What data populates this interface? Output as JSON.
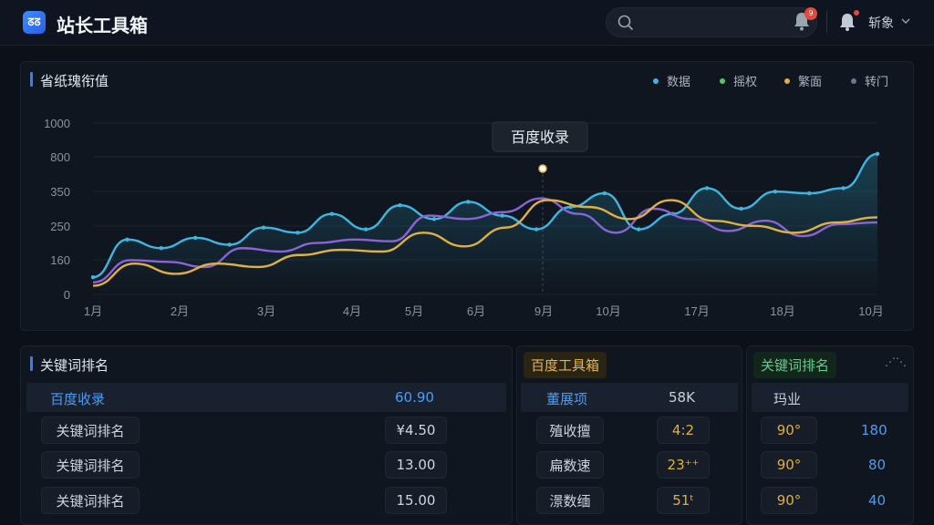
{
  "header": {
    "logo_text": "ᘔᘔ",
    "app_title": "站长工具箱",
    "search_placeholder": "",
    "notification_count": "9",
    "user_name": "斩象"
  },
  "chart_panel": {
    "title": "省纸瑰衔值",
    "legend": [
      {
        "label": "数据",
        "color": "#3fb6e0"
      },
      {
        "label": "摇权",
        "color": "#52c86a"
      },
      {
        "label": "繁面",
        "color": "#e0b040"
      },
      {
        "label": "转门",
        "color": "#7a7f9a"
      }
    ],
    "tooltip": "百度收录"
  },
  "chart_data": {
    "type": "line",
    "title": "省纸瑰衔值",
    "categories": [
      "1月",
      "2月",
      "3月",
      "4月",
      "5月",
      "6月",
      "9月",
      "10月",
      "17月",
      "18月",
      "10月"
    ],
    "yticks": [
      "1000",
      "800",
      "350",
      "250",
      "160",
      "0"
    ],
    "grid": true,
    "series": [
      {
        "color": "#3fb6e0",
        "values": [
          1.0,
          3.2,
          2.7,
          3.3,
          2.9,
          3.9,
          3.6,
          4.7,
          3.8,
          5.2,
          4.4,
          5.4,
          4.6,
          3.8,
          5.1,
          5.9,
          3.8,
          4.7,
          6.2,
          5.0,
          6.0,
          5.9,
          6.2,
          8.2
        ]
      },
      {
        "color": "#8a64d6",
        "values": [
          0.7,
          2.0,
          1.9,
          1.6,
          2.7,
          2.5,
          3.0,
          3.2,
          3.1,
          4.6,
          4.4,
          4.8,
          5.6,
          4.7,
          3.6,
          5.0,
          4.4,
          3.7,
          4.3,
          3.4,
          4.1,
          4.2
        ]
      },
      {
        "color": "#e0b040",
        "values": [
          0.5,
          1.8,
          1.2,
          1.8,
          1.6,
          2.3,
          2.6,
          2.5,
          3.6,
          2.8,
          3.9,
          5.5,
          5.1,
          4.4,
          5.5,
          4.3,
          4.0,
          3.6,
          4.2,
          4.5
        ]
      }
    ]
  },
  "keyword_panel": {
    "title": "关键词排名",
    "rows": [
      {
        "label": "百度收录",
        "value": "60.90"
      },
      {
        "label": "关键词排名",
        "value": "¥4.50"
      },
      {
        "label": "关键词排名",
        "value": "13.00"
      },
      {
        "label": "关键词排名",
        "value": "15.00"
      }
    ]
  },
  "baidu_panel": {
    "title": "百度工具箱",
    "rows": [
      {
        "label": "董展项",
        "value": "58K"
      },
      {
        "label": "殖收擅",
        "value": "4:2"
      },
      {
        "label": "扁数速",
        "value": "23⁺⁺"
      },
      {
        "label": "澋数缅",
        "value": "51ᵗ"
      }
    ]
  },
  "rank_panel": {
    "title": "关键词排名",
    "more": "⋰⋱",
    "header": "玛业",
    "rows": [
      {
        "label": "90°",
        "value": "180"
      },
      {
        "label": "90°",
        "value": "80"
      },
      {
        "label": "90°",
        "value": "40"
      }
    ]
  }
}
